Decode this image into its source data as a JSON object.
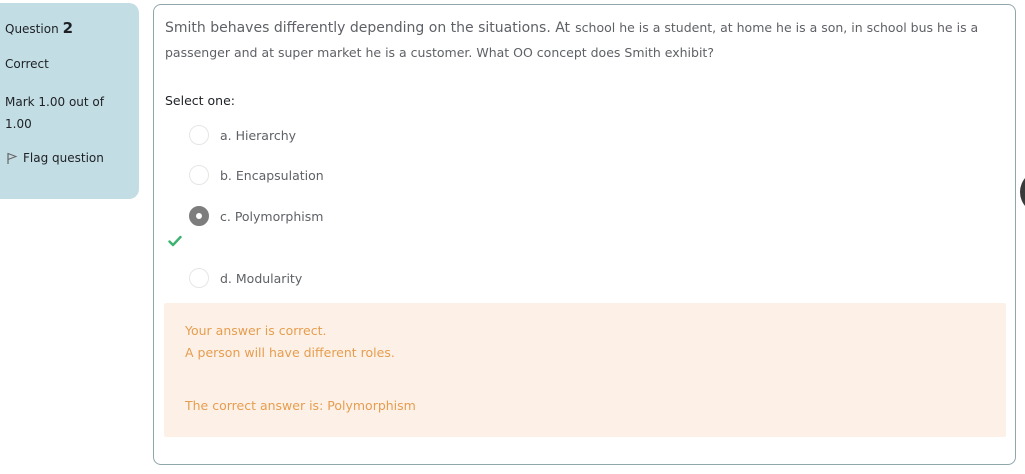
{
  "info": {
    "question_prefix": "Question",
    "question_number": "2",
    "state": "Correct",
    "grade": "Mark 1.00 out of 1.00",
    "flag_label": "Flag question"
  },
  "question": {
    "text_large": "Smith behaves differently depending on the situations. At",
    "text_small": "school he is a student, at home he is a son, in school bus he is a",
    "text_line2": "passenger and at super market he is a customer.  What OO concept does Smith exhibit?",
    "prompt": "Select one:"
  },
  "answers": [
    {
      "label": "a. Hierarchy",
      "selected": false
    },
    {
      "label": "b. Encapsulation",
      "selected": false
    },
    {
      "label": "c. Polymorphism",
      "selected": true,
      "correct": true
    },
    {
      "label": "d. Modularity",
      "selected": false
    }
  ],
  "feedback": {
    "result": "Your answer is correct.",
    "general": "A person will have different roles.",
    "right_answer": "The correct answer is: Polymorphism"
  },
  "colors": {
    "info_bg": "#c3dde4",
    "feedback_bg": "#fdf1e7",
    "feedback_text": "#e69d4f",
    "correct_check": "#3cb371"
  }
}
